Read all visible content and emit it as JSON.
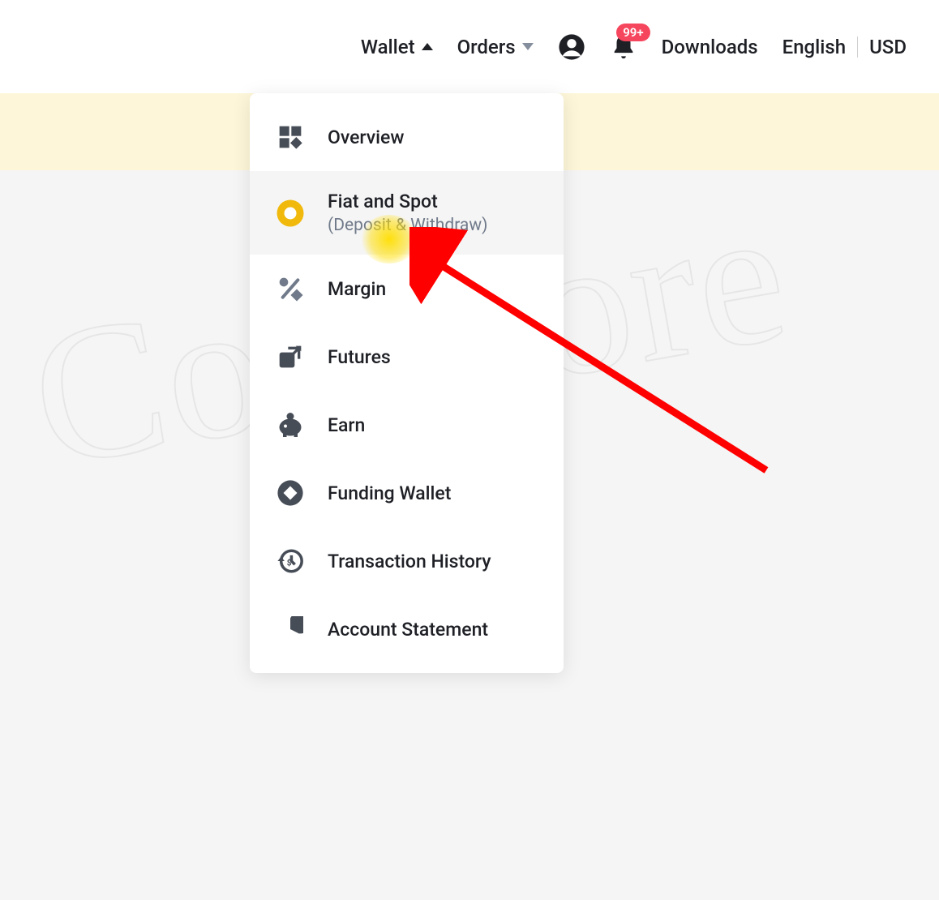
{
  "header": {
    "wallet_label": "Wallet",
    "orders_label": "Orders",
    "downloads_label": "Downloads",
    "language_label": "English",
    "currency_label": "USD",
    "notification_badge": "99+"
  },
  "dropdown": {
    "items": [
      {
        "label": "Overview",
        "icon": "grid-icon"
      },
      {
        "label": "Fiat and Spot",
        "sublabel": "(Deposit & Withdraw)",
        "icon": "coin-icon",
        "active": true
      },
      {
        "label": "Margin",
        "icon": "percent-icon"
      },
      {
        "label": "Futures",
        "icon": "futures-icon"
      },
      {
        "label": "Earn",
        "icon": "piggy-icon"
      },
      {
        "label": "Funding Wallet",
        "icon": "diamond-icon"
      },
      {
        "label": "Transaction History",
        "icon": "history-icon"
      },
      {
        "label": "Account Statement",
        "icon": "pie-icon"
      }
    ]
  },
  "watermark": "CoinLore"
}
